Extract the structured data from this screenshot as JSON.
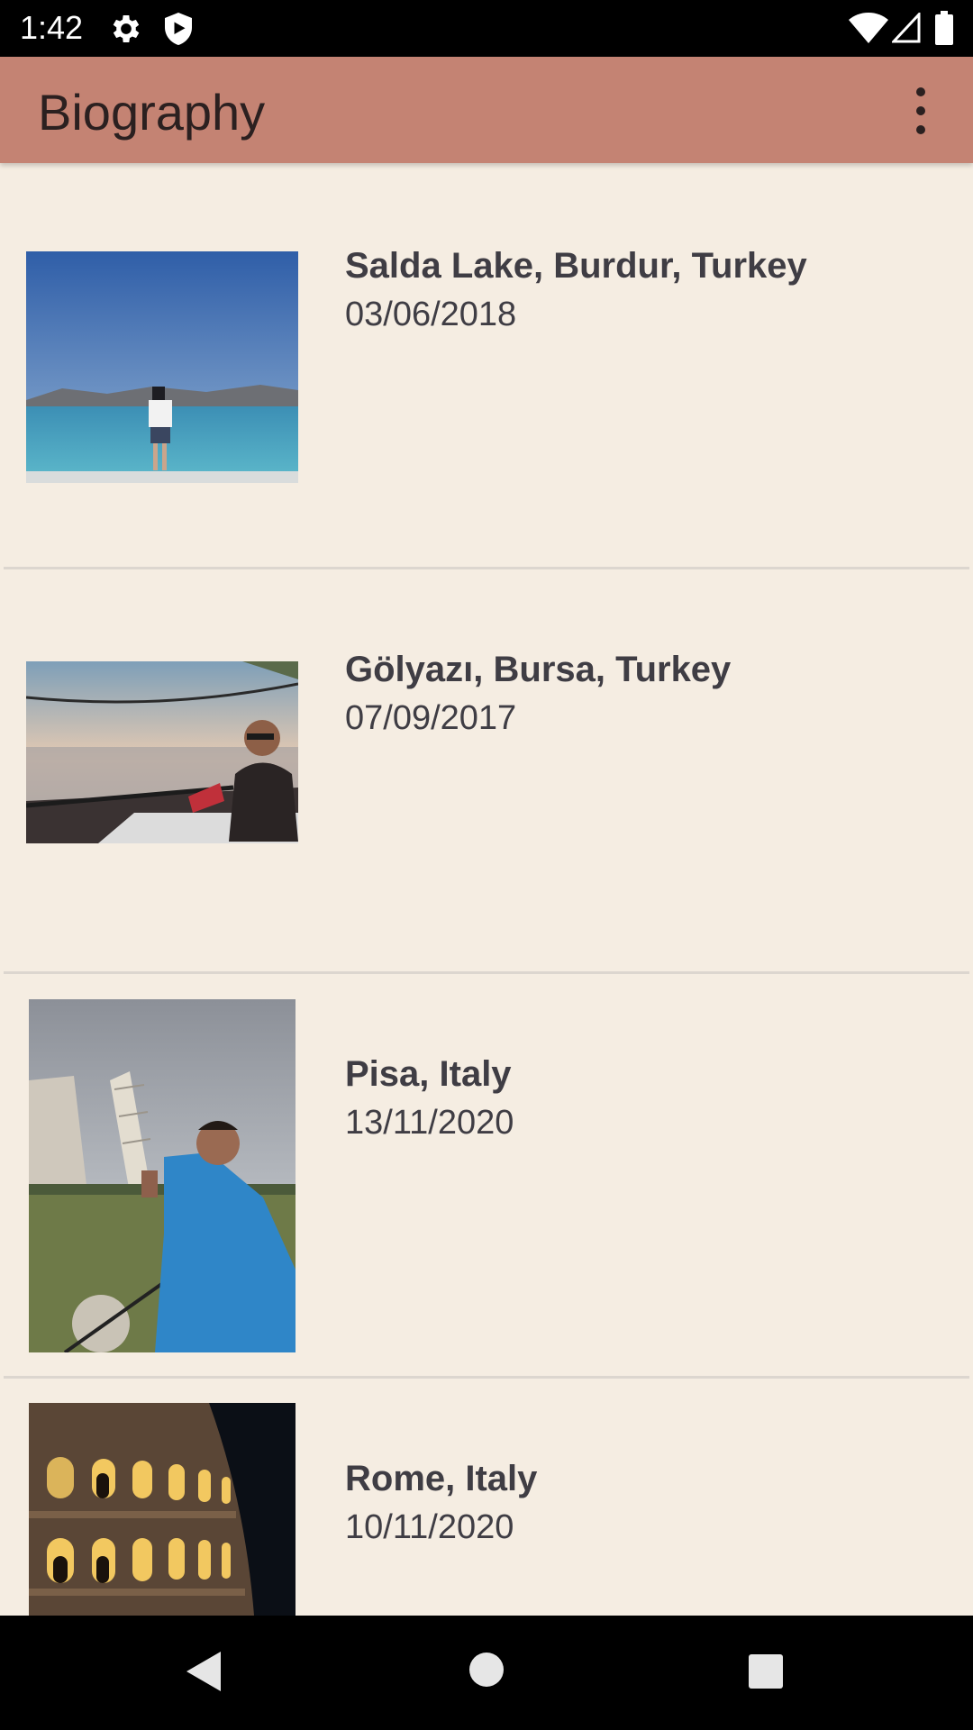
{
  "status_bar": {
    "time": "1:42",
    "icons": [
      "gear-icon",
      "shield-icon",
      "wifi-icon",
      "signal-icon",
      "battery-icon"
    ]
  },
  "app_bar": {
    "title": "Biography",
    "overflow_icon": "more-vert-icon"
  },
  "list": {
    "items": [
      {
        "title": "Salda Lake, Burdur, Turkey",
        "date": "03/06/2018",
        "image": "lake-photo"
      },
      {
        "title": "Gölyazı, Bursa, Turkey",
        "date": "07/09/2017",
        "image": "boat-sunset-photo"
      },
      {
        "title": "Pisa, Italy",
        "date": "13/11/2020",
        "image": "leaning-tower-photo"
      },
      {
        "title": "Rome, Italy",
        "date": "10/11/2020",
        "image": "colosseum-photo"
      }
    ]
  },
  "nav_bar": {
    "icons": [
      "back-icon",
      "home-icon",
      "recents-icon"
    ]
  },
  "colors": {
    "app_bar": "#c48373",
    "background": "#f5ede2",
    "text": "#3f3d44"
  }
}
